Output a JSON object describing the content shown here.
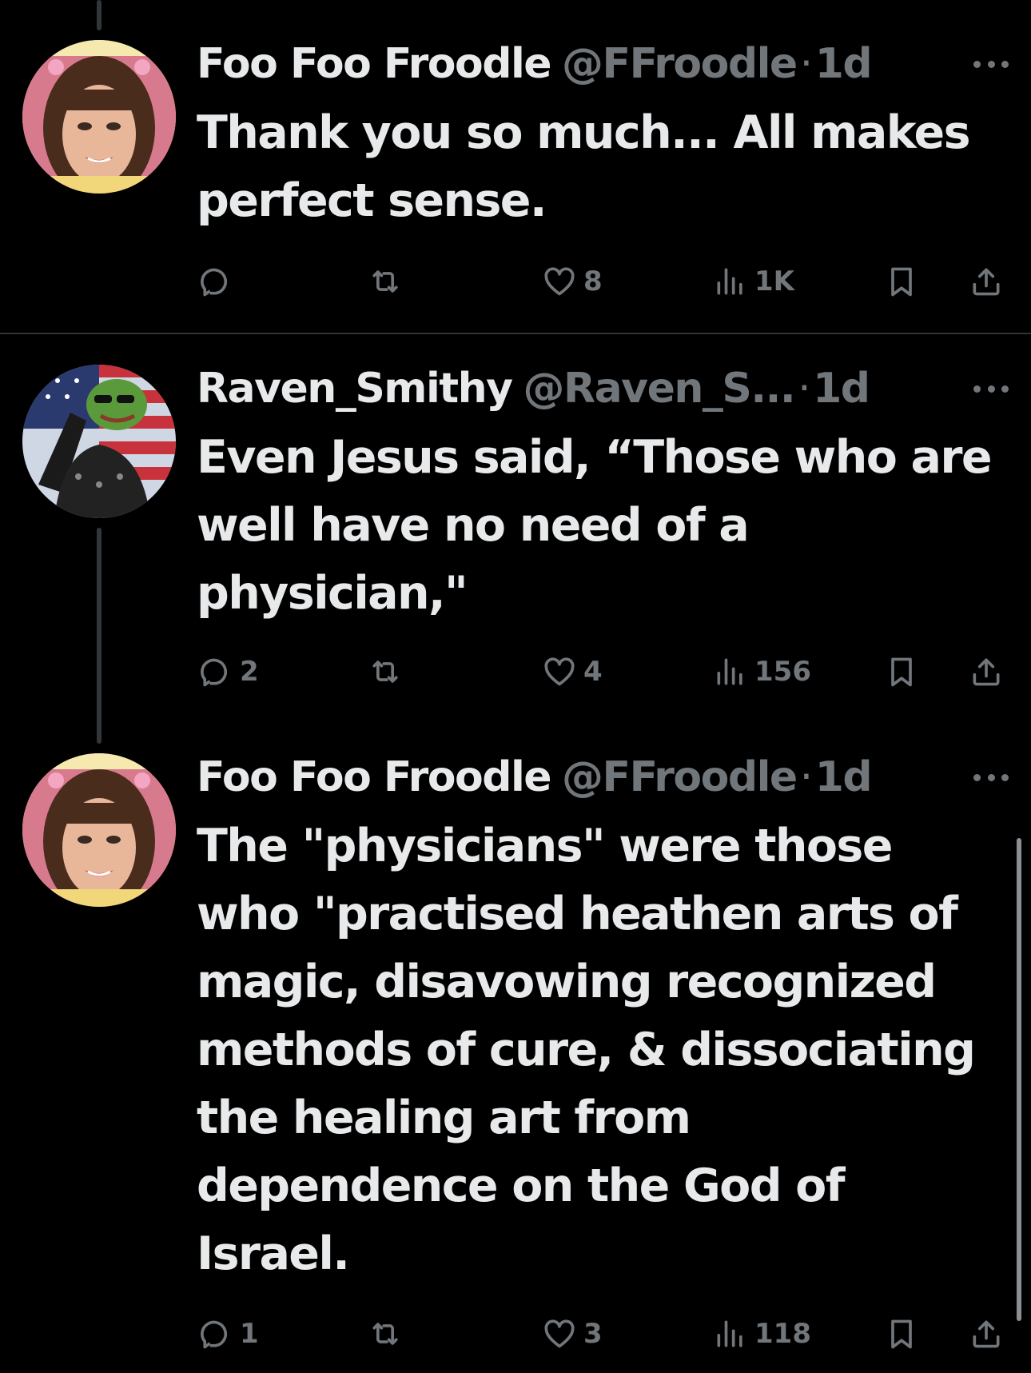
{
  "colors": {
    "background": "#000000",
    "text": "#e7e9ea",
    "secondary": "#71767b",
    "divider": "#2f3336"
  },
  "tweets": [
    {
      "name": "Foo Foo Froodle",
      "handle": "@FFroodle",
      "separator": "·",
      "time": "1d",
      "text": "Thank you so much... All makes perfect sense.",
      "replies": "",
      "retweets": "",
      "likes": "8",
      "views": "1K",
      "icons": [
        "reply-icon",
        "retweet-icon",
        "like-icon",
        "views-icon",
        "bookmark-icon",
        "share-icon"
      ]
    },
    {
      "name": "Raven_Smithy",
      "handle": "@Raven_S...",
      "separator": "·",
      "time": "1d",
      "text": "Even Jesus said, “Those who are well have no need of a physician,\"",
      "replies": "2",
      "retweets": "",
      "likes": "4",
      "views": "156",
      "icons": [
        "reply-icon",
        "retweet-icon",
        "like-icon",
        "views-icon",
        "bookmark-icon",
        "share-icon"
      ]
    },
    {
      "name": "Foo Foo Froodle",
      "handle": "@FFroodle",
      "separator": "·",
      "time": "1d",
      "text": "The \"physicians\" were those who \"practised heathen arts of magic, disavowing recognized methods of cure, & dissociating the healing art from dependence on the God of Israel.",
      "replies": "1",
      "retweets": "",
      "likes": "3",
      "views": "118",
      "icons": [
        "reply-icon",
        "retweet-icon",
        "like-icon",
        "views-icon",
        "bookmark-icon",
        "share-icon"
      ]
    }
  ]
}
